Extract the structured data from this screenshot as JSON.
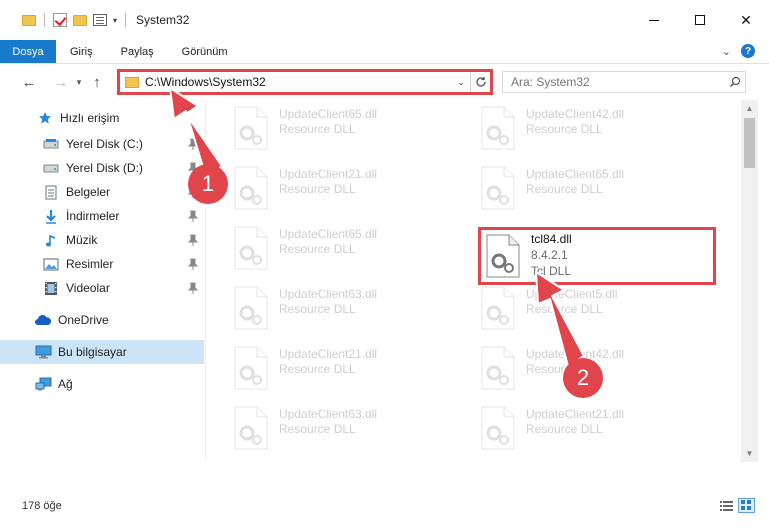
{
  "window": {
    "title": "System32"
  },
  "ribbon": {
    "tabs": [
      "Dosya",
      "Giriş",
      "Paylaş",
      "Görünüm"
    ],
    "help_label": "?"
  },
  "nav": {
    "address": "C:\\Windows\\System32",
    "search_placeholder": "Ara: System32"
  },
  "sidebar": {
    "items": [
      {
        "label": "Hızlı erişim",
        "icon": "star-icon"
      },
      {
        "label": "Yerel Disk (C:)",
        "icon": "drive-icon"
      },
      {
        "label": "Yerel Disk (D:)",
        "icon": "drive-icon"
      },
      {
        "label": "Belgeler",
        "icon": "documents-icon"
      },
      {
        "label": "İndirmeler",
        "icon": "download-icon"
      },
      {
        "label": "Müzik",
        "icon": "music-icon"
      },
      {
        "label": "Resimler",
        "icon": "pictures-icon"
      },
      {
        "label": "Videolar",
        "icon": "video-icon"
      },
      {
        "label": "OneDrive",
        "icon": "cloud-icon"
      },
      {
        "label": "Bu bilgisayar",
        "icon": "computer-icon"
      },
      {
        "label": "Ağ",
        "icon": "network-icon"
      }
    ]
  },
  "files": [
    {
      "name": "UpdateClient65.dll",
      "sub": "Resource DLL"
    },
    {
      "name": "UpdateClient42.dll",
      "sub": "Resource DLL"
    },
    {
      "name": "UpdateClient21.dll",
      "sub": "Resource DLL"
    },
    {
      "name": "UpdateClient65.dll",
      "sub": "Resource DLL"
    },
    {
      "name": "UpdateClient65.dll",
      "sub": "Resource DLL"
    },
    {
      "name": "tcl84.dll",
      "version": "8.4.2.1",
      "sub": "Tcl DLL"
    },
    {
      "name": "UpdateClient63.dll",
      "sub": "Resource DLL"
    },
    {
      "name": "UpdateClient5.dll",
      "sub": "Resource DLL"
    },
    {
      "name": "UpdateClient21.dll",
      "sub": "Resource DLL"
    },
    {
      "name": "UpdateClient42.dll",
      "sub": "Resource DLL"
    },
    {
      "name": "UpdateClient63.dll",
      "sub": "Resource DLL"
    },
    {
      "name": "UpdateClient21.dll",
      "sub": "Resource DLL"
    }
  ],
  "status": {
    "count": "178 öğe"
  },
  "annotations": {
    "step1": "1",
    "step2": "2",
    "color": "#e0454b"
  }
}
